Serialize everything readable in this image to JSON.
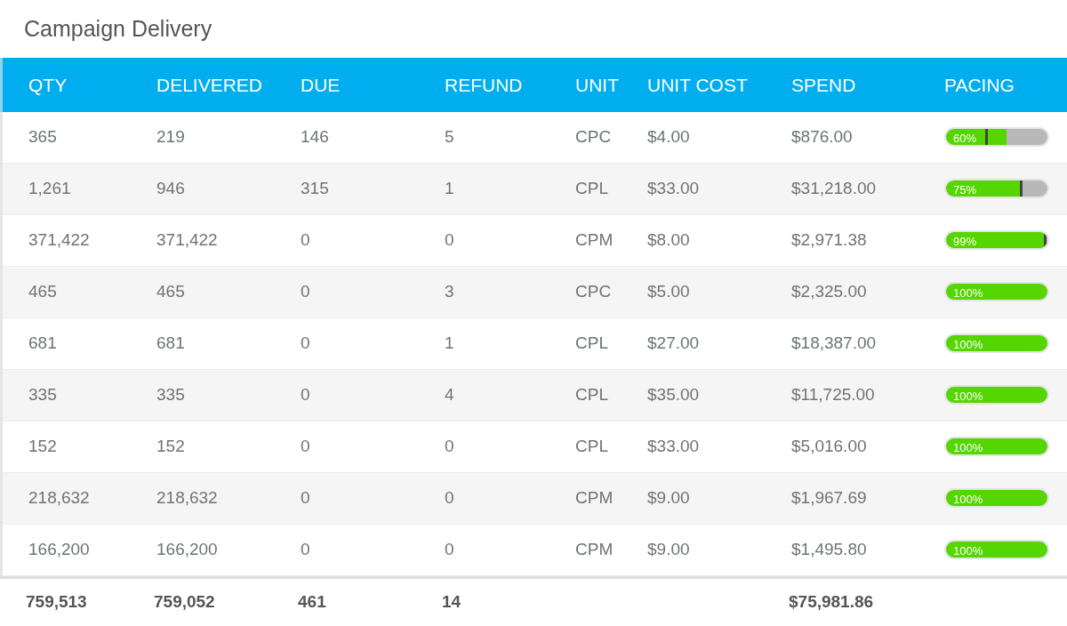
{
  "title": "Campaign Delivery",
  "columns": [
    "QTY",
    "DELIVERED",
    "DUE",
    "REFUND",
    "UNIT",
    "UNIT COST",
    "SPEND",
    "PACING"
  ],
  "rows": [
    {
      "cells": [
        "365",
        "219",
        "146",
        "5",
        "CPC",
        "$4.00",
        "$876.00"
      ],
      "pacing": {
        "label": "60%",
        "level": 0.6,
        "marker": {
          "level": 0.41
        }
      }
    },
    {
      "cells": [
        "1,261",
        "946",
        "315",
        "1",
        "CPL",
        "$33.00",
        "$31,218.00"
      ],
      "pacing": {
        "label": "75%",
        "level": 0.75,
        "marker": {
          "level": 0.75
        }
      }
    },
    {
      "cells": [
        "371,422",
        "371,422",
        "0",
        "0",
        "CPM",
        "$8.00",
        "$2,971.38"
      ],
      "pacing": {
        "label": "99%",
        "level": 0.99,
        "marker": {
          "level": 0.99
        }
      }
    },
    {
      "cells": [
        "465",
        "465",
        "0",
        "3",
        "CPC",
        "$5.00",
        "$2,325.00"
      ],
      "pacing": {
        "label": "100%",
        "level": 1
      }
    },
    {
      "cells": [
        "681",
        "681",
        "0",
        "1",
        "CPL",
        "$27.00",
        "$18,387.00"
      ],
      "pacing": {
        "label": "100%",
        "level": 1
      }
    },
    {
      "cells": [
        "335",
        "335",
        "0",
        "4",
        "CPL",
        "$35.00",
        "$11,725.00"
      ],
      "pacing": {
        "label": "100%",
        "level": 1
      }
    },
    {
      "cells": [
        "152",
        "152",
        "0",
        "0",
        "CPL",
        "$33.00",
        "$5,016.00"
      ],
      "pacing": {
        "label": "100%",
        "level": 1
      }
    },
    {
      "cells": [
        "218,632",
        "218,632",
        "0",
        "0",
        "CPM",
        "$9.00",
        "$1,967.69"
      ],
      "pacing": {
        "label": "100%",
        "level": 1
      }
    },
    {
      "cells": [
        "166,200",
        "166,200",
        "0",
        "0",
        "CPM",
        "$9.00",
        "$1,495.80"
      ],
      "pacing": {
        "label": "100%",
        "level": 1
      }
    }
  ],
  "totals": {
    "qty": "759,513",
    "delivered": "759,052",
    "due": "461",
    "refund": "14",
    "spend": "$75,981.86"
  }
}
